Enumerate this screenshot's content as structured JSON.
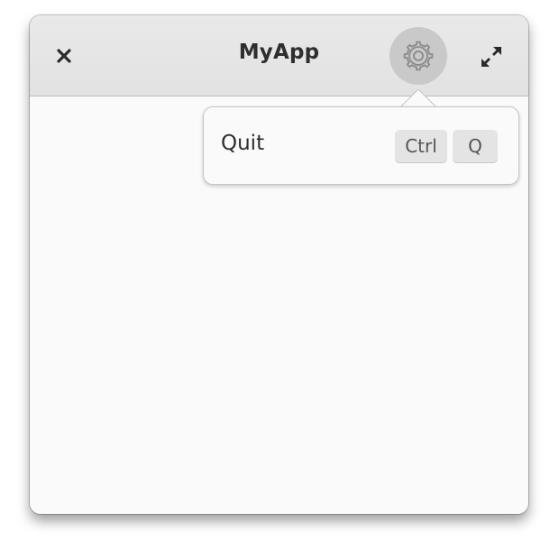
{
  "window": {
    "title": "MyApp"
  },
  "headerbar": {
    "close_icon": "close-icon",
    "menu_icon": "gear-icon",
    "maximize_icon": "maximize-icon"
  },
  "popover": {
    "items": [
      {
        "label": "Quit",
        "shortcut": [
          "Ctrl",
          "Q"
        ]
      }
    ]
  },
  "colors": {
    "headerbar_bg": "#e5e5e5",
    "content_bg": "#fafafa",
    "gear_button_active_bg": "#c9c9c9",
    "key_bg": "#e4e4e4"
  }
}
